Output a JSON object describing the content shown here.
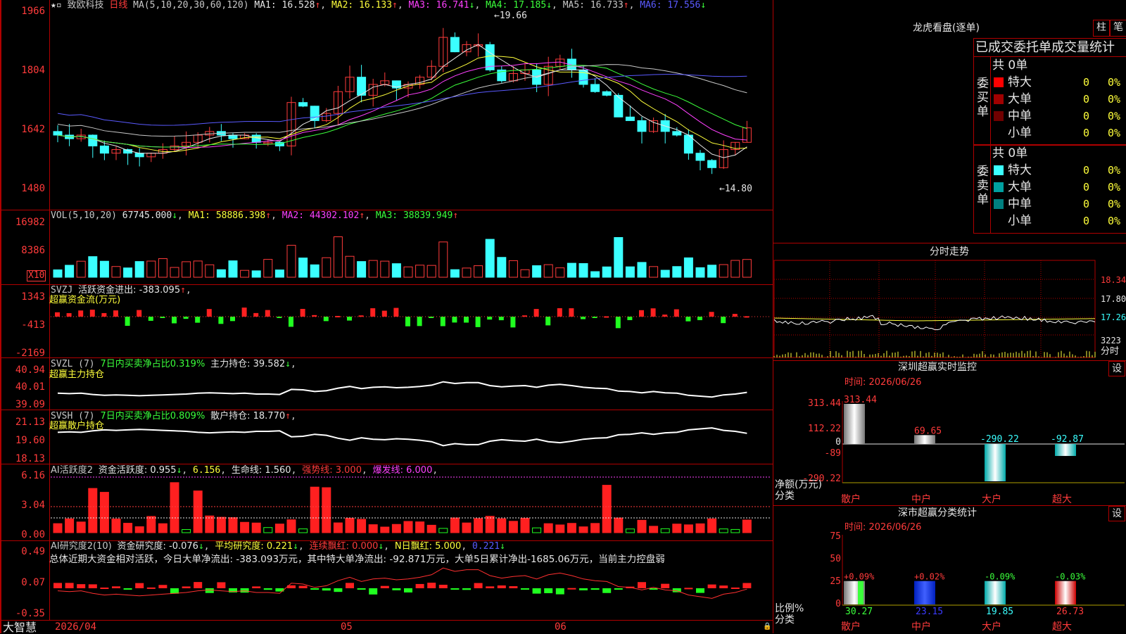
{
  "stock": {
    "name": "致欧科技",
    "period": "日线",
    "ma_label": "MA(5,10,20,30,60,120)",
    "ma": [
      {
        "t": "MA1: 16.528",
        "a": "↑"
      },
      {
        "t": "MA2: 16.133",
        "a": "↑"
      },
      {
        "t": "MA3: 16.741",
        "a": "↓"
      },
      {
        "t": "MA4: 17.185",
        "a": "↓"
      },
      {
        "t": "MA5: 16.733",
        "a": "↑"
      },
      {
        "t": "MA6: 17.556",
        "a": "↓"
      }
    ],
    "high_mark": "←19.66",
    "low_mark": "←14.80"
  },
  "price_axis": [
    "1966",
    "1804",
    "1642",
    "1480"
  ],
  "vol": {
    "label": "VOL(5,10,20)",
    "v": "67745.000",
    "a": "↓",
    "ma1": "MA1: 58886.398",
    "ma1a": "↑",
    "ma2": "MA2: 44302.102",
    "ma2a": "↑",
    "ma3": "MA3: 38839.949",
    "ma3a": "↑",
    "axis": [
      "16982",
      "8386"
    ],
    "unit": "X10"
  },
  "svzj": {
    "label": "SVZJ",
    "desc": "活跃资金进出: -383.095",
    "a": "↑",
    "sub": "超赢资金流(万元)",
    "axis": [
      "1343",
      "-413",
      "-2169"
    ]
  },
  "svzl": {
    "label": "SVZL (7)",
    "desc": "7日内买卖净占比0.319%",
    "hold": "主力持仓: 39.582",
    "a": "↓",
    "sub": "超赢主力持仓",
    "axis": [
      "40.94",
      "40.01",
      "39.09"
    ]
  },
  "svsh": {
    "label": "SVSH (7)",
    "desc": "7日内买卖净占比0.809%",
    "hold": "散户持仓: 18.770",
    "a": "↑",
    "sub": "超赢散户持仓",
    "axis": [
      "21.13",
      "19.60",
      "18.13"
    ]
  },
  "ai1": {
    "label": "AI活跃度2",
    "t1": "资金活跃度: 0.955",
    "a1": "↓",
    "t2": "6.156",
    "t3": "生命线: 1.560",
    "t4": "强势线: 3.000",
    "t5": "爆发线: 6.000",
    "axis": [
      "6.16",
      "3.04",
      "0.00"
    ]
  },
  "ai2": {
    "label": "AI研究度2(10)",
    "t1": "资金研究度: -0.076",
    "a1": "↓",
    "t2": "平均研究度: 0.221",
    "a2": "↓",
    "t3": "连续飘红: 0.000",
    "a3": "↓",
    "t4": "N日飘红: 5.000",
    "t5": "0.221",
    "a5": "↓",
    "summary": "总体近期大资金相对活跃，今日大单净流出: -383.093万元，其中特大单净流出: -92.871万元，大单5日累计净出-1685.06万元，当前主力控盘弱",
    "axis": [
      "0.49",
      "0.07",
      "-0.35"
    ]
  },
  "footer": {
    "brand": "大智慧",
    "date": "2026/04",
    "m05": "05",
    "m06": "06"
  },
  "dragon": {
    "title": "龙虎看盘(逐单)",
    "btn1": "柱",
    "btn2": "笔",
    "tabs": [
      "已成交",
      "委托单",
      "成交量",
      "统计"
    ],
    "buy": {
      "head": "共 0单",
      "side": "委买单",
      "rows": [
        {
          "n": "特大",
          "v": "0",
          "p": "0%",
          "c": "#ff0000"
        },
        {
          "n": "大单",
          "v": "0",
          "p": "0%",
          "c": "#a00000"
        },
        {
          "n": "中单",
          "v": "0",
          "p": "0%",
          "c": "#700000"
        },
        {
          "n": "小单",
          "v": "0",
          "p": "0%",
          "c": "#000000"
        }
      ]
    },
    "sell": {
      "head": "共 0单",
      "side": "委卖单",
      "rows": [
        {
          "n": "特大",
          "v": "0",
          "p": "0%",
          "c": "#3bffff"
        },
        {
          "n": "大单",
          "v": "0",
          "p": "0%",
          "c": "#00a0a0"
        },
        {
          "n": "中单",
          "v": "0",
          "p": "0%",
          "c": "#008080"
        },
        {
          "n": "小单",
          "v": "0",
          "p": "0%",
          "c": "#000000"
        }
      ]
    }
  },
  "intraday": {
    "title": "分时走势",
    "axis": [
      "18.34",
      "17.80",
      "17.26"
    ],
    "vol": "3223",
    "fs": "分时"
  },
  "monitor": {
    "title": "深圳超赢实时监控",
    "btn": "设",
    "time": "时间: 2026/06/26",
    "axis": [
      "313.44",
      "112.22",
      "0",
      "-89",
      "-290.22"
    ],
    "ylab": "净额(万元)",
    "xlab": "分类"
  },
  "stats": {
    "title": "深市超赢分类统计",
    "btn": "设",
    "time": "时间: 2026/06/26",
    "axis": [
      "75",
      "50",
      "25",
      "0"
    ],
    "ylab": "比例%",
    "xlab": "分类"
  },
  "chart_data": [
    {
      "type": "bar",
      "title": "深圳超赢实时监控",
      "xlabel": "分类",
      "ylabel": "净额(万元)",
      "categories": [
        "散户",
        "中户",
        "大户",
        "超大"
      ],
      "values": [
        313.44,
        69.65,
        -290.22,
        -92.87
      ],
      "ylim": [
        -290.22,
        313.44
      ]
    },
    {
      "type": "bar",
      "title": "深市超赢分类统计",
      "xlabel": "分类",
      "ylabel": "比例%",
      "categories": [
        "散户",
        "中户",
        "大户",
        "超大"
      ],
      "values": [
        30.27,
        23.15,
        19.85,
        26.73
      ],
      "changes": [
        "+0.09%",
        "+0.02%",
        "-0.09%",
        "-0.03%"
      ],
      "ylim": [
        0,
        75
      ]
    }
  ]
}
